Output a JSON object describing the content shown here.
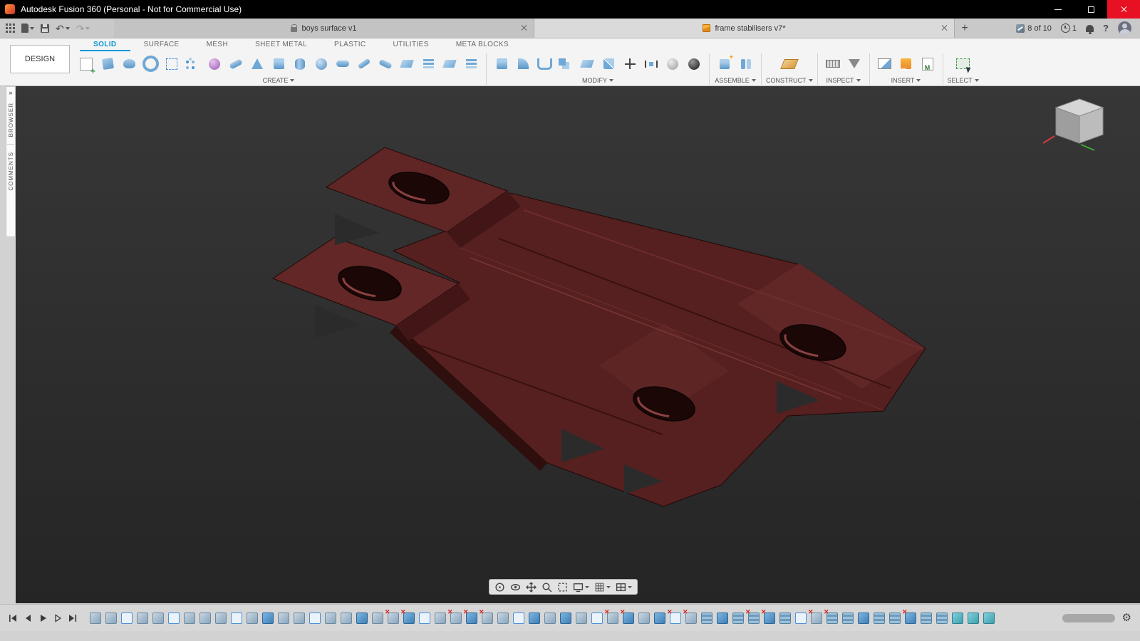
{
  "title_bar": {
    "title": "Autodesk Fusion 360 (Personal - Not for Commercial Use)"
  },
  "quick_access": {
    "undo_glyph": "↶",
    "redo_glyph": "↷"
  },
  "document_tabs": {
    "tabs": [
      {
        "name": "doc-tab-boys-surface",
        "label": "boys surface v1"
      },
      {
        "name": "doc-tab-frame-stabilisers",
        "label": "frame stabilisers v7*",
        "active": true
      }
    ],
    "add_glyph": "+",
    "trial_counter": "8 of 10",
    "job_badge": "1",
    "help_glyph": "?"
  },
  "ribbon": {
    "tabs": [
      {
        "name": "ribbon-tab-solid",
        "label": "SOLID",
        "active": true
      },
      {
        "name": "ribbon-tab-surface",
        "label": "SURFACE"
      },
      {
        "name": "ribbon-tab-mesh",
        "label": "MESH"
      },
      {
        "name": "ribbon-tab-sheet-metal",
        "label": "SHEET METAL"
      },
      {
        "name": "ribbon-tab-plastic",
        "label": "PLASTIC"
      },
      {
        "name": "ribbon-tab-utilities",
        "label": "UTILITIES"
      },
      {
        "name": "ribbon-tab-meta-blocks",
        "label": "META BLOCKS"
      }
    ]
  },
  "workspace": {
    "label": "DESIGN"
  },
  "toolbar": {
    "create": {
      "label": "CREATE",
      "icons": [
        {
          "name": "create-sketch-icon",
          "type": "sketch"
        },
        {
          "name": "extrude-icon",
          "type": "extrude"
        },
        {
          "name": "revolve-icon",
          "type": "loft"
        },
        {
          "name": "hole-icon",
          "type": "revolve"
        },
        {
          "name": "rectangular-pattern-icon",
          "type": "cornerdots"
        },
        {
          "name": "circular-pattern-icon",
          "type": "dots"
        },
        {
          "name": "create-form-icon",
          "type": "form"
        },
        {
          "name": "sweep-icon",
          "type": "sweep"
        },
        {
          "name": "loft-icon",
          "type": "cone"
        },
        {
          "name": "box-icon",
          "type": "box"
        },
        {
          "name": "cylinder-icon",
          "type": "cyl"
        },
        {
          "name": "sphere-icon",
          "type": "sphere"
        },
        {
          "name": "torus-icon",
          "type": "pill"
        },
        {
          "name": "coil-icon",
          "type": "coil"
        },
        {
          "name": "pipe-icon",
          "type": "sweep2"
        },
        {
          "name": "thicken-icon",
          "type": "patch"
        },
        {
          "name": "boundary-fill-icon",
          "type": "sheets"
        },
        {
          "name": "ruled-surface-icon",
          "type": "patch"
        },
        {
          "name": "pattern-icon",
          "type": "sheets"
        }
      ]
    },
    "modify": {
      "label": "MODIFY",
      "icons": [
        {
          "name": "press-pull-icon",
          "type": "box"
        },
        {
          "name": "fillet-icon",
          "type": "fillet"
        },
        {
          "name": "shell-icon",
          "type": "shell"
        },
        {
          "name": "combine-icon",
          "type": "combine"
        },
        {
          "name": "offset-face-icon",
          "type": "patch"
        },
        {
          "name": "split-body-icon",
          "type": "split"
        },
        {
          "name": "move-copy-icon",
          "type": "move"
        },
        {
          "name": "align-icon",
          "type": "align"
        },
        {
          "name": "physical-material-icon",
          "type": "material"
        },
        {
          "name": "appearance-icon",
          "type": "appearance"
        }
      ]
    },
    "assemble": {
      "label": "ASSEMBLE",
      "icons": [
        {
          "name": "new-component-icon",
          "type": "newcomp"
        },
        {
          "name": "joint-icon",
          "type": "joint"
        }
      ]
    },
    "construct": {
      "label": "CONSTRUCT",
      "icons": [
        {
          "name": "construct-plane-icon",
          "type": "plane"
        }
      ]
    },
    "inspect": {
      "label": "INSPECT",
      "icons": [
        {
          "name": "measure-icon",
          "type": "measure"
        },
        {
          "name": "section-analysis-icon",
          "type": "analyze"
        }
      ]
    },
    "insert": {
      "label": "INSERT",
      "icons": [
        {
          "name": "insert-canvas-icon",
          "type": "canvas"
        },
        {
          "name": "insert-svg-icon",
          "type": "svgins"
        },
        {
          "name": "insert-mcmaster-icon",
          "type": "mcmaster"
        }
      ]
    },
    "select": {
      "label": "SELECT",
      "icons": [
        {
          "name": "select-tool-icon",
          "type": "select"
        }
      ]
    }
  },
  "side_panel": {
    "expand_glyph": "»",
    "panels": [
      {
        "name": "panel-browser",
        "label": "BROWSER"
      },
      {
        "name": "panel-comments",
        "label": "COMMENTS"
      }
    ]
  },
  "navbar": {
    "icons": [
      "free-orbit-icon",
      "look-at-icon",
      "pan-icon",
      "zoom-icon",
      "fit-icon",
      "display-settings-icon",
      "grid-settings-icon",
      "viewports-icon"
    ]
  },
  "timeline": {
    "gear_glyph": "⚙",
    "features": [
      {
        "t": "sheet"
      },
      {
        "t": "sheet"
      },
      {
        "t": "sketch"
      },
      {
        "t": "sheet"
      },
      {
        "t": "sheet"
      },
      {
        "t": "sketch"
      },
      {
        "t": "sheet"
      },
      {
        "t": "sheet"
      },
      {
        "t": "sheet"
      },
      {
        "t": "sketch"
      },
      {
        "t": "sheet"
      },
      {
        "t": "solid"
      },
      {
        "t": "sheet"
      },
      {
        "t": "sheet"
      },
      {
        "t": "sketch"
      },
      {
        "t": "sheet"
      },
      {
        "t": "sheet"
      },
      {
        "t": "solid"
      },
      {
        "t": "sheet"
      },
      {
        "t": "sheet",
        "e": true
      },
      {
        "t": "solid",
        "e": true
      },
      {
        "t": "sketch"
      },
      {
        "t": "sheet"
      },
      {
        "t": "sheet",
        "e": true
      },
      {
        "t": "solid",
        "e": true
      },
      {
        "t": "sheet",
        "e": true
      },
      {
        "t": "sheet"
      },
      {
        "t": "sketch"
      },
      {
        "t": "solid"
      },
      {
        "t": "sheet"
      },
      {
        "t": "solid"
      },
      {
        "t": "sheet"
      },
      {
        "t": "sketch"
      },
      {
        "t": "sheet",
        "e": true
      },
      {
        "t": "solid",
        "e": true
      },
      {
        "t": "sheet"
      },
      {
        "t": "solid"
      },
      {
        "t": "sketch",
        "e": true
      },
      {
        "t": "sheet",
        "e": true
      },
      {
        "t": "stack"
      },
      {
        "t": "solid"
      },
      {
        "t": "stack"
      },
      {
        "t": "stack",
        "e": true
      },
      {
        "t": "solid",
        "e": true
      },
      {
        "t": "stack"
      },
      {
        "t": "sketch"
      },
      {
        "t": "sheet",
        "e": true
      },
      {
        "t": "stack",
        "e": true
      },
      {
        "t": "stack"
      },
      {
        "t": "solid"
      },
      {
        "t": "stack"
      },
      {
        "t": "stack"
      },
      {
        "t": "solid",
        "e": true
      },
      {
        "t": "stack"
      },
      {
        "t": "stack"
      },
      {
        "t": "teal"
      },
      {
        "t": "teal"
      },
      {
        "t": "teal"
      }
    ]
  },
  "colors": {
    "accent": "#0696d7",
    "close_button": "#e81123",
    "model_body": "#5a2222",
    "viewport_bg": "#2b2b2b"
  }
}
